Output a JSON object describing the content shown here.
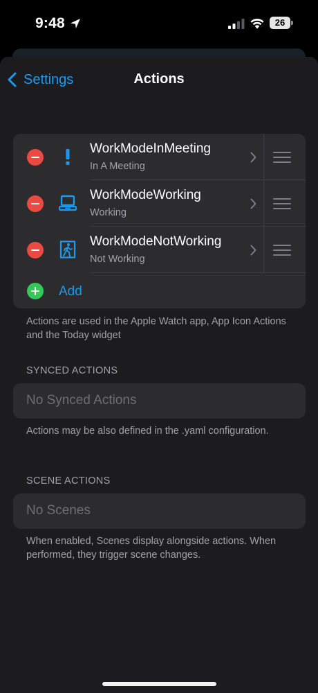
{
  "status": {
    "time": "9:48",
    "battery": "26",
    "icons": [
      "location-arrow-icon",
      "cellular-signal-icon",
      "wifi-icon",
      "battery-icon"
    ]
  },
  "nav": {
    "back_label": "Settings",
    "title": "Actions"
  },
  "actions": [
    {
      "title": "WorkModeInMeeting",
      "subtitle": "In A Meeting",
      "icon": "exclamation-icon"
    },
    {
      "title": "WorkModeWorking",
      "subtitle": "Working",
      "icon": "laptop-icon"
    },
    {
      "title": "WorkModeNotWorking",
      "subtitle": "Not Working",
      "icon": "exit-door-icon"
    }
  ],
  "add_label": "Add",
  "actions_footer": "Actions are used in the Apple Watch app, App Icon Actions and the Today widget",
  "synced": {
    "header": "SYNCED ACTIONS",
    "empty": "No Synced Actions",
    "footer": "Actions may be also defined in the .yaml configuration."
  },
  "scenes": {
    "header": "SCENE ACTIONS",
    "empty": "No Scenes",
    "footer": "When enabled, Scenes display alongside actions. When performed, they trigger scene changes."
  },
  "colors": {
    "accent": "#1a9bf0",
    "delete": "#e94a41",
    "add": "#34c759",
    "card": "#2c2c2e",
    "sheet": "#1c1c1e"
  }
}
